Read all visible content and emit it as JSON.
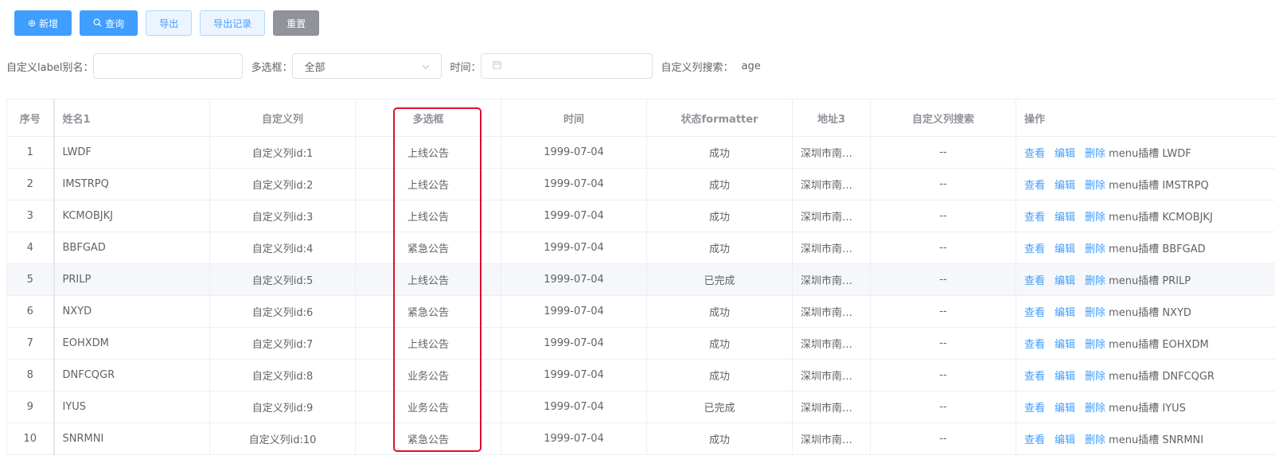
{
  "toolbar": {
    "add_label": "新增",
    "query_label": "查询",
    "export_label": "导出",
    "export_records_label": "导出记录",
    "reset_label": "重置"
  },
  "filters": {
    "alias_label": "自定义label别名：",
    "alias_value": "",
    "multiselect_label": "多选框：",
    "multiselect_value": "全部",
    "time_label": "时间：",
    "time_value": "",
    "custom_search_label": "自定义列搜索：",
    "custom_search_value": "age"
  },
  "table": {
    "columns": [
      "序号",
      "姓名1",
      "自定义列",
      "多选框",
      "时间",
      "状态formatter",
      "地址3",
      "自定义列搜索",
      "操作"
    ],
    "actions": {
      "view": "查看",
      "edit": "编辑",
      "delete": "删除",
      "menu_prefix": "menu插槽"
    },
    "rows": [
      {
        "idx": "1",
        "name": "LWDF",
        "custom": "自定义列id:1",
        "multi": "上线公告",
        "time": "1999-07-04",
        "status": "成功",
        "addr": "深圳市南…",
        "search": "--"
      },
      {
        "idx": "2",
        "name": "IMSTRPQ",
        "custom": "自定义列id:2",
        "multi": "上线公告",
        "time": "1999-07-04",
        "status": "成功",
        "addr": "深圳市南…",
        "search": "--"
      },
      {
        "idx": "3",
        "name": "KCMOBJKJ",
        "custom": "自定义列id:3",
        "multi": "上线公告",
        "time": "1999-07-04",
        "status": "成功",
        "addr": "深圳市南…",
        "search": "--"
      },
      {
        "idx": "4",
        "name": "BBFGAD",
        "custom": "自定义列id:4",
        "multi": "紧急公告",
        "time": "1999-07-04",
        "status": "成功",
        "addr": "深圳市南…",
        "search": "--"
      },
      {
        "idx": "5",
        "name": "PRILP",
        "custom": "自定义列id:5",
        "multi": "上线公告",
        "time": "1999-07-04",
        "status": "已完成",
        "addr": "深圳市南…",
        "search": "--"
      },
      {
        "idx": "6",
        "name": "NXYD",
        "custom": "自定义列id:6",
        "multi": "紧急公告",
        "time": "1999-07-04",
        "status": "成功",
        "addr": "深圳市南…",
        "search": "--"
      },
      {
        "idx": "7",
        "name": "EOHXDM",
        "custom": "自定义列id:7",
        "multi": "上线公告",
        "time": "1999-07-04",
        "status": "成功",
        "addr": "深圳市南…",
        "search": "--"
      },
      {
        "idx": "8",
        "name": "DNFCQGR",
        "custom": "自定义列id:8",
        "multi": "业务公告",
        "time": "1999-07-04",
        "status": "成功",
        "addr": "深圳市南…",
        "search": "--"
      },
      {
        "idx": "9",
        "name": "IYUS",
        "custom": "自定义列id:9",
        "multi": "业务公告",
        "time": "1999-07-04",
        "status": "已完成",
        "addr": "深圳市南…",
        "search": "--"
      },
      {
        "idx": "10",
        "name": "SNRMNI",
        "custom": "自定义列id:10",
        "multi": "紧急公告",
        "time": "1999-07-04",
        "status": "成功",
        "addr": "深圳市南…",
        "search": "--"
      }
    ]
  },
  "colors": {
    "primary": "#409eff",
    "highlight_border": "#e0102e",
    "hover_row": "#f5f7fa"
  }
}
